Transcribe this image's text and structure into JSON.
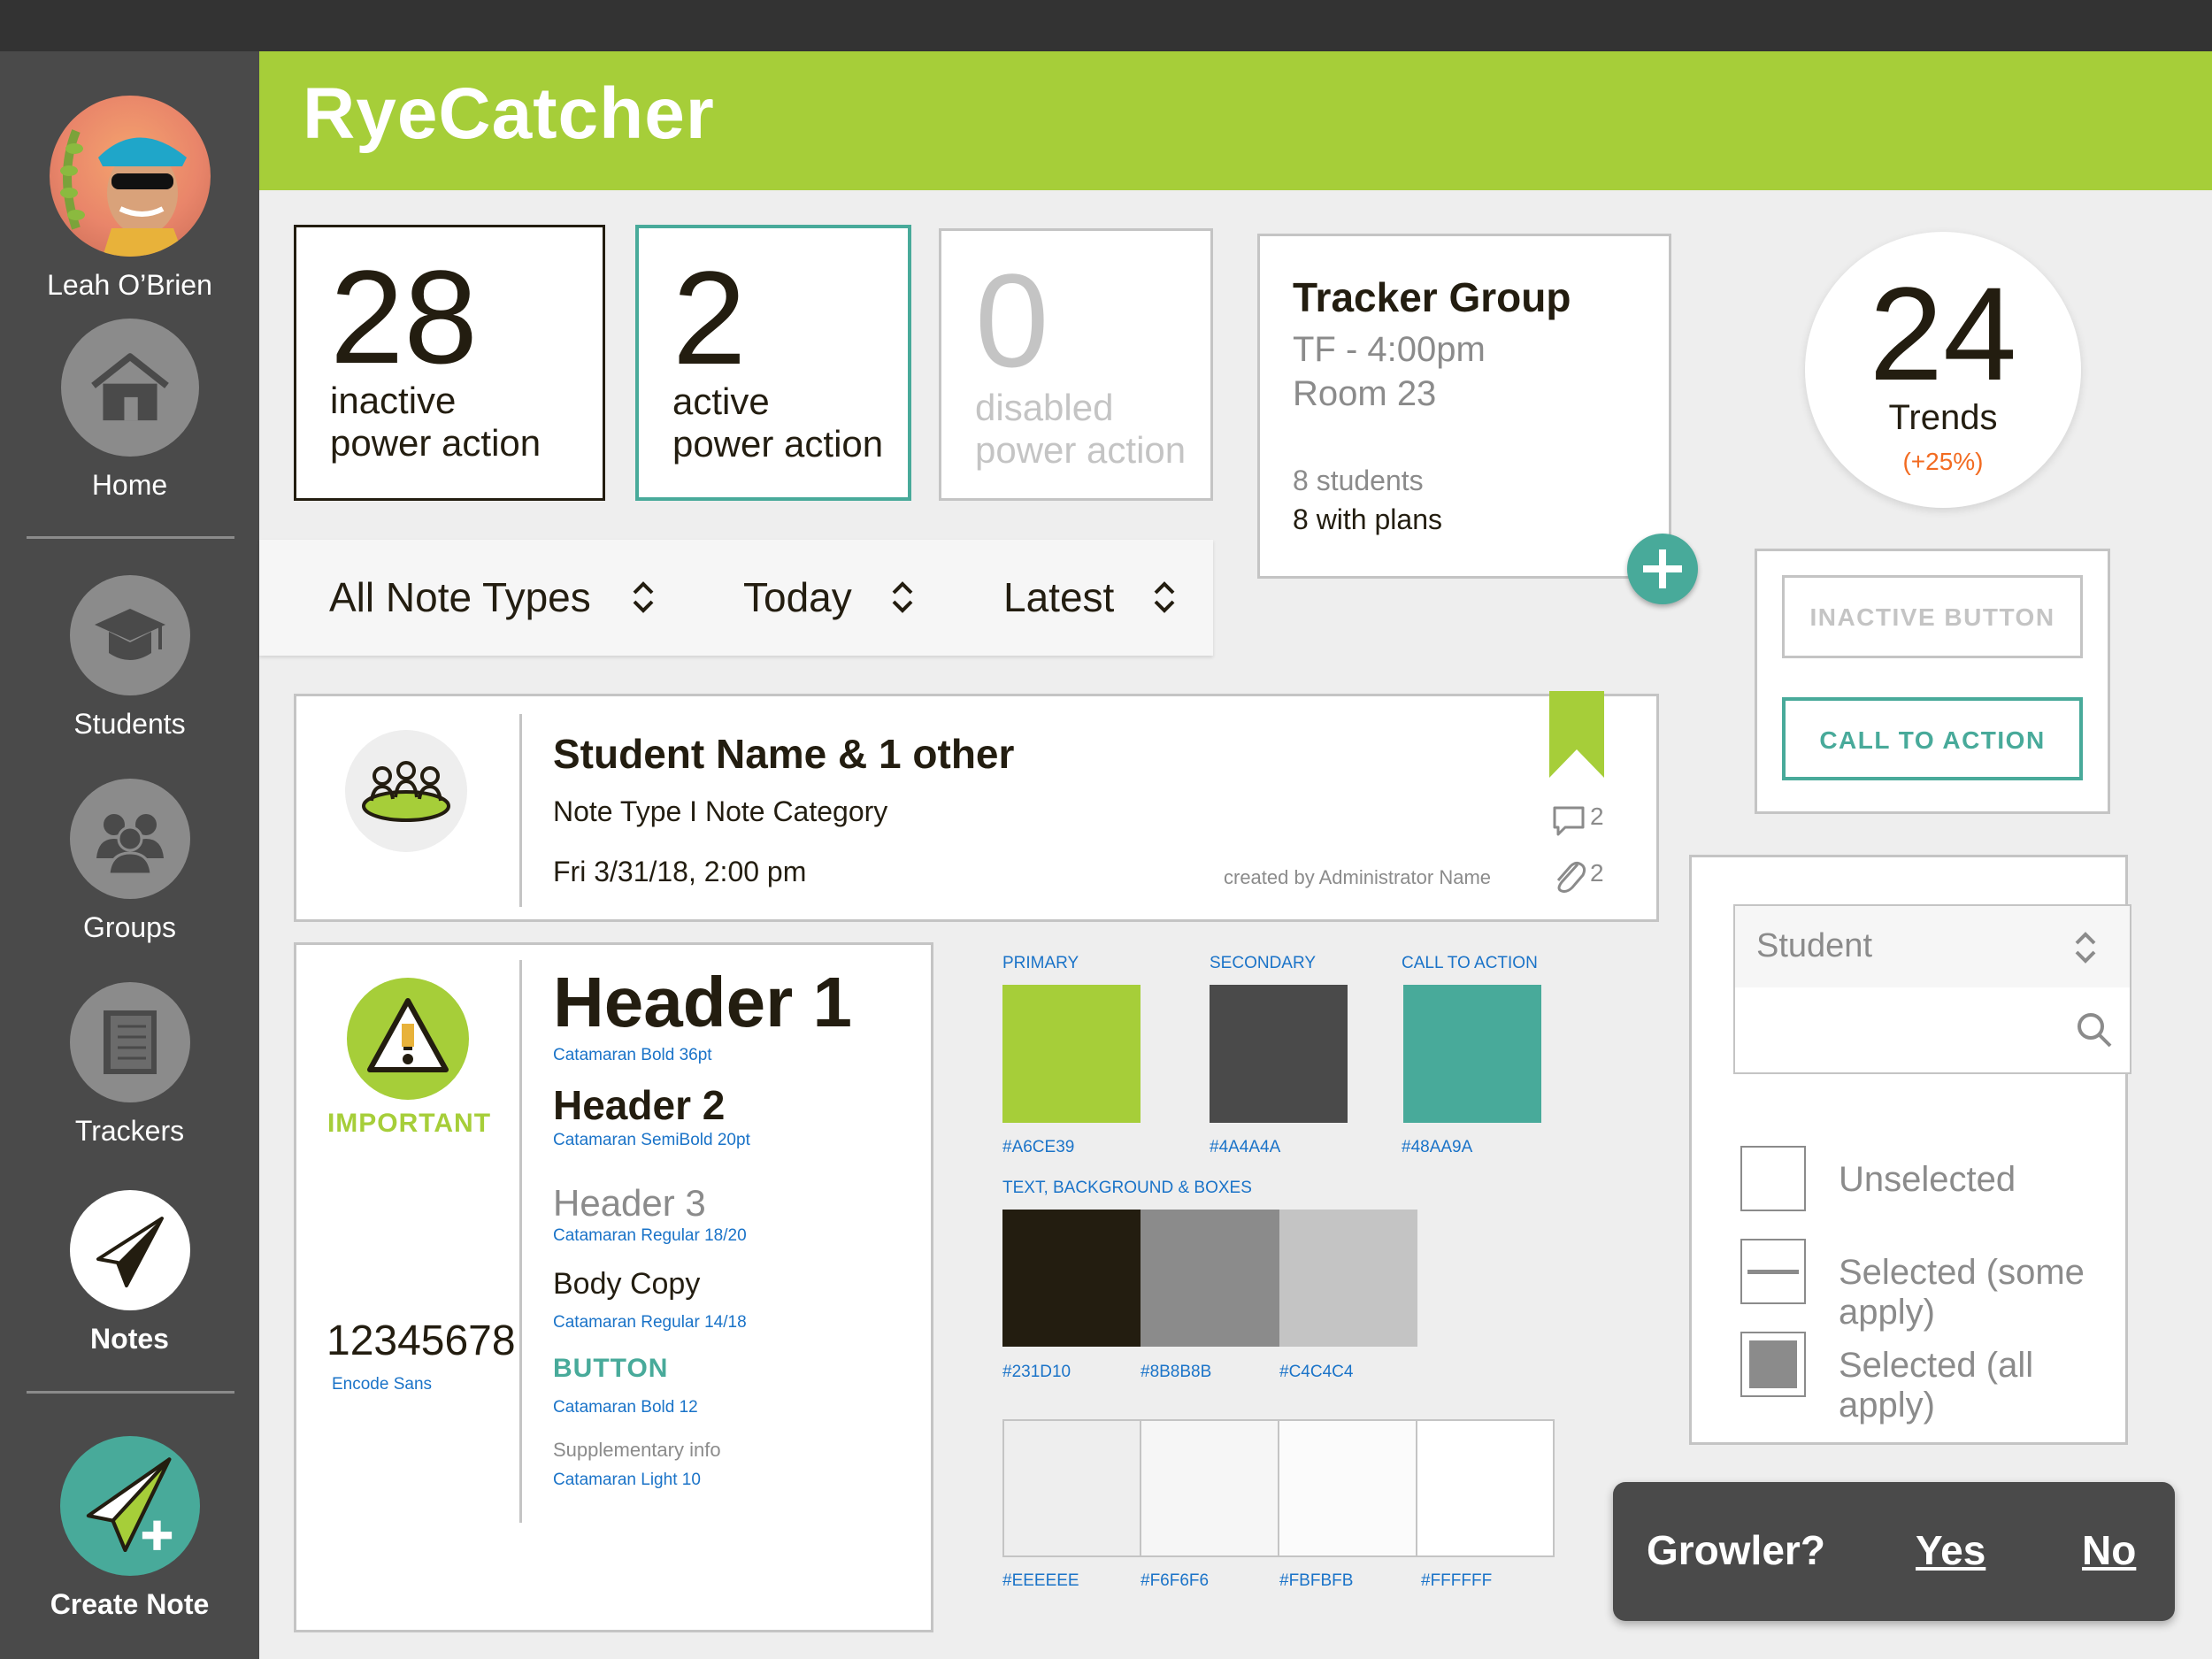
{
  "app": {
    "title": "RyeCatcher"
  },
  "user": {
    "name": "Leah O’Brien"
  },
  "sidebar": {
    "items": [
      {
        "label": "Home",
        "icon": "home-icon"
      },
      {
        "label": "Students",
        "icon": "graduation-cap-icon"
      },
      {
        "label": "Groups",
        "icon": "group-icon"
      },
      {
        "label": "Trackers",
        "icon": "notebook-icon"
      },
      {
        "label": "Notes",
        "icon": "paper-plane-icon"
      }
    ],
    "create_note": "Create Note"
  },
  "power_actions": [
    {
      "number": "28",
      "line1": "inactive",
      "line2": "power action"
    },
    {
      "number": "2",
      "line1": "active",
      "line2": "power action"
    },
    {
      "number": "0",
      "line1": "disabled",
      "line2": "power action"
    }
  ],
  "filters": {
    "type": "All Note Types",
    "date": "Today",
    "sort": "Latest"
  },
  "tracker": {
    "title": "Tracker Group",
    "schedule": "TF - 4:00pm",
    "room": "Room 23",
    "students": "8 students",
    "plans": "8 with plans"
  },
  "trends": {
    "value": "24",
    "label": "Trends",
    "change": "(+25%)"
  },
  "buttons": {
    "inactive": "INACTIVE BUTTON",
    "cta": "CALL TO ACTION"
  },
  "note": {
    "title": "Student Name & 1 other",
    "type": "Note Type I Note Category",
    "date": "Fri 3/31/18, 2:00 pm",
    "created_by": "created by Administrator Name",
    "comments": "2",
    "attachments": "2"
  },
  "typography": {
    "important": "IMPORTANT",
    "numbers": "12345678",
    "numbers_font": "Encode Sans",
    "h1": "Header 1",
    "h1_spec": "Catamaran Bold 36pt",
    "h2": "Header 2",
    "h2_spec": "Catamaran SemiBold 20pt",
    "h3": "Header 3",
    "h3_spec": "Catamaran Regular 18/20",
    "body": "Body Copy",
    "body_spec": "Catamaran Regular 14/18",
    "button": "BUTTON",
    "button_spec": "Catamaran Bold 12",
    "supp": "Supplementary info",
    "supp_spec": "Catamaran Light 10"
  },
  "colors": {
    "primary_label": "PRIMARY",
    "primary": "#A6CE39",
    "secondary_label": "SECONDARY",
    "secondary": "#4A4A4A",
    "cta_label": "CALL TO ACTION",
    "cta": "#48AA9A",
    "text_label": "TEXT, BACKGROUND & BOXES",
    "row1": [
      "#231D10",
      "#8B8B8B",
      "#C4C4C4"
    ],
    "row2": [
      "#EEEEEE",
      "#F6F6F6",
      "#FBFBFB",
      "#FFFFFF"
    ]
  },
  "form": {
    "select_value": "Student",
    "search_placeholder": "",
    "checks": [
      "Unselected",
      "Selected (some apply)",
      "Selected (all apply)"
    ]
  },
  "growler": {
    "text": "Growler?",
    "yes": "Yes",
    "no": "No"
  }
}
